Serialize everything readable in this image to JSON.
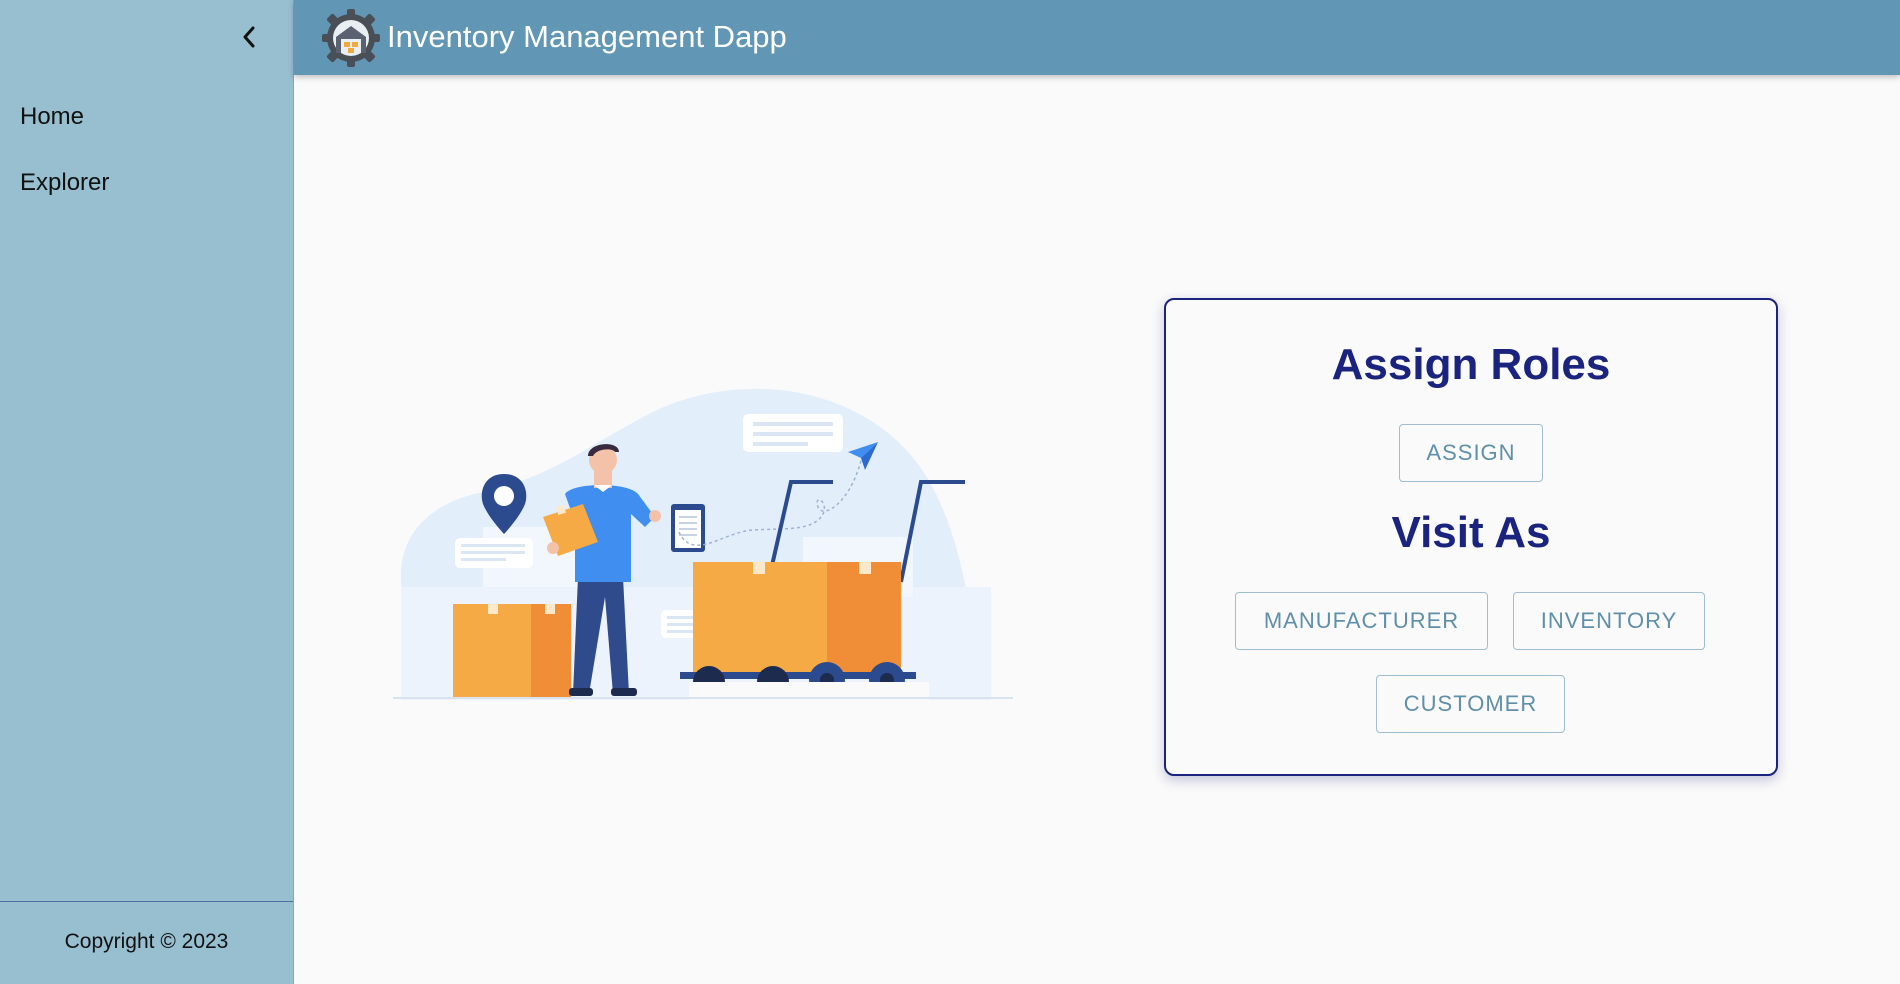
{
  "sidebar": {
    "items": [
      {
        "label": "Home"
      },
      {
        "label": "Explorer"
      }
    ],
    "copyright": "Copyright © 2023"
  },
  "header": {
    "title": "Inventory Management Dapp"
  },
  "card": {
    "assign_heading": "Assign Roles",
    "assign_button": "ASSIGN",
    "visit_heading": "Visit As",
    "manufacturer_button": "MANUFACTURER",
    "inventory_button": "INVENTORY",
    "customer_button": "CUSTOMER"
  },
  "colors": {
    "sidebar": "#97bfd0",
    "header": "#6196b4",
    "heading": "#1a237e",
    "button_text": "#5f8fa9"
  },
  "icons": [
    "chevron-left-icon",
    "warehouse-gear-logo-icon"
  ]
}
